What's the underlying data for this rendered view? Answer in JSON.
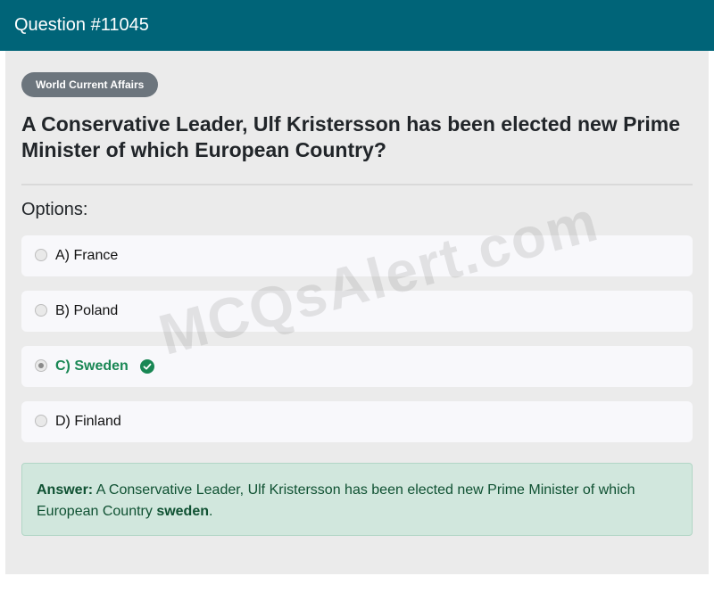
{
  "header": {
    "title": "Question #11045"
  },
  "category": "World Current Affairs",
  "question": "A Conservative Leader, Ulf Kristersson has been elected new Prime Minister of which European Country?",
  "options_label": "Options:",
  "options": [
    {
      "label": "A) France",
      "selected": false,
      "correct": false
    },
    {
      "label": "B) Poland",
      "selected": false,
      "correct": false
    },
    {
      "label": "C) Sweden",
      "selected": true,
      "correct": true,
      "icon": "check-circle-icon"
    },
    {
      "label": "D) Finland",
      "selected": false,
      "correct": false
    }
  ],
  "answer": {
    "prefix": "Answer:",
    "text": " A Conservative Leader, Ulf Kristersson has been elected new Prime Minister of which European Country ",
    "highlight": "sweden",
    "suffix": "."
  },
  "watermark": "MCQsAlert.com",
  "colors": {
    "header_bg": "#006478",
    "correct": "#198754",
    "answer_bg": "#d1e7dd",
    "badge_bg": "#6c757d"
  }
}
